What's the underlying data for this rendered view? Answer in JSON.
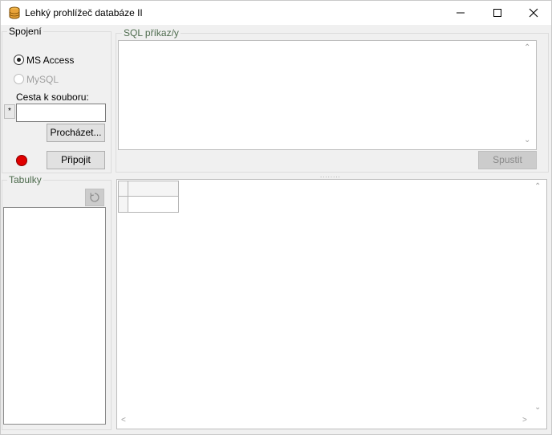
{
  "window": {
    "title": "Lehký prohlížeč databáze II",
    "icon": "database-icon",
    "controls": [
      "minimize-icon",
      "maximize-icon",
      "close-icon"
    ]
  },
  "connection": {
    "legend": "Spojení",
    "options": [
      {
        "label": "MS Access",
        "selected": true,
        "enabled": true
      },
      {
        "label": "MySQL",
        "selected": false,
        "enabled": false
      }
    ],
    "path_label": "Cesta k souboru:",
    "path_value": "",
    "path_marker": "*",
    "browse_label": "Procházet...",
    "connect_label": "Připojit",
    "status_color": "#e00000"
  },
  "tables": {
    "legend": "Tabulky",
    "refresh_icon": "refresh-icon",
    "items": []
  },
  "sql": {
    "legend": "SQL příkaz/y",
    "value": "",
    "run_label": "Spustit",
    "run_enabled": false
  },
  "results": {
    "columns": [
      ""
    ],
    "rows": [
      [
        ""
      ]
    ]
  }
}
